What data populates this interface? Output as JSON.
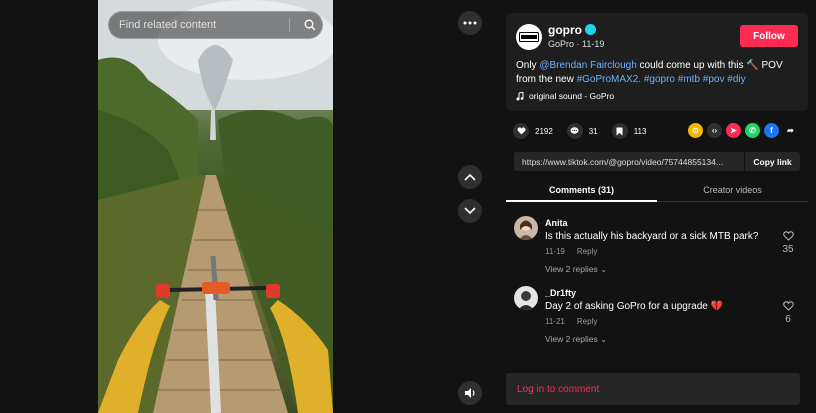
{
  "search": {
    "placeholder": "Find related content"
  },
  "post": {
    "author": "gopro",
    "author_sub": "GoPro · 11-19",
    "logo_text": "GoPro",
    "follow_label": "Follow",
    "desc_part1": "Only ",
    "mention": "@Brendan Fairclough",
    "desc_part2": " could come up with this 🔨 POV from the new ",
    "tags": [
      "#GoProMAX2.",
      "#gopro",
      "#mtb",
      "#pov",
      "#diy"
    ],
    "sound": "original sound - GoPro"
  },
  "stats": {
    "likes": "2192",
    "comments": "31",
    "saves": "113"
  },
  "share_colors": [
    "#f5b800",
    "#2f2f2f",
    "#fe2c55",
    "#25d366",
    "#1877f2"
  ],
  "link": {
    "url": "https://www.tiktok.com/@gopro/video/75744855134...",
    "copy_label": "Copy link"
  },
  "tabs": {
    "comments": "Comments (31)",
    "creator": "Creator videos"
  },
  "comments": [
    {
      "user": "Anita",
      "text": "Is this actually his backyard or a sick MTB park?",
      "date": "11-19",
      "reply": "Reply",
      "views": "View 2 replies ⌄",
      "likes": "35"
    },
    {
      "user": "_Dr1fty",
      "text": "Day 2 of asking GoPro for a upgrade 💔",
      "date": "11-21",
      "reply": "Reply",
      "views": "View 2 replies ⌄",
      "likes": "6"
    }
  ],
  "login": "Log in to comment",
  "colors": {
    "accent": "#fe2c55",
    "link": "#6cb2ff",
    "verified": "#20d5ec"
  }
}
